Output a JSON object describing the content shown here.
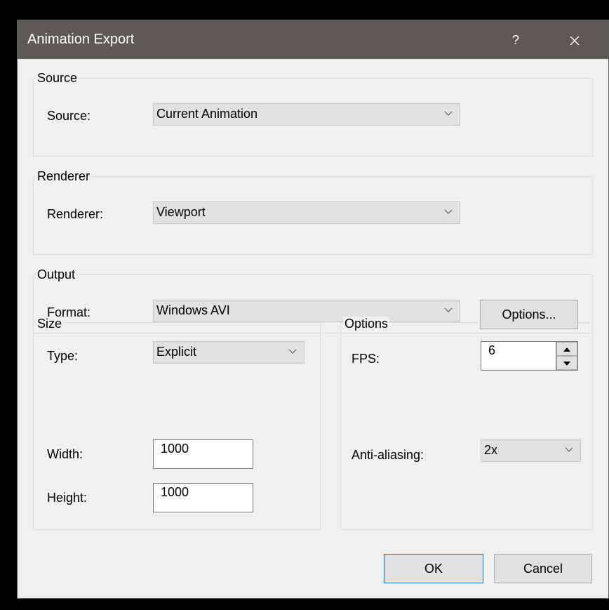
{
  "window": {
    "title": "Animation Export",
    "help_label": "?",
    "close_icon": "close-icon"
  },
  "source": {
    "group_label": "Source",
    "field_label": "Source:",
    "value": "Current Animation"
  },
  "renderer": {
    "group_label": "Renderer",
    "field_label": "Renderer:",
    "value": "Viewport"
  },
  "output": {
    "group_label": "Output",
    "field_label": "Format:",
    "value": "Windows AVI",
    "options_button": "Options..."
  },
  "size": {
    "group_label": "Size",
    "type_label": "Type:",
    "type_value": "Explicit",
    "width_label": "Width:",
    "width_value": "1000",
    "height_label": "Height:",
    "height_value": "1000"
  },
  "options": {
    "group_label": "Options",
    "fps_label": "FPS:",
    "fps_value": "6",
    "aa_label": "Anti-aliasing:",
    "aa_value": "2x"
  },
  "buttons": {
    "ok": "OK",
    "cancel": "Cancel"
  },
  "colors": {
    "titlebar": "#5d5a55",
    "dialog_bg": "#f0f0f0",
    "default_button_border": "#0078d7"
  }
}
